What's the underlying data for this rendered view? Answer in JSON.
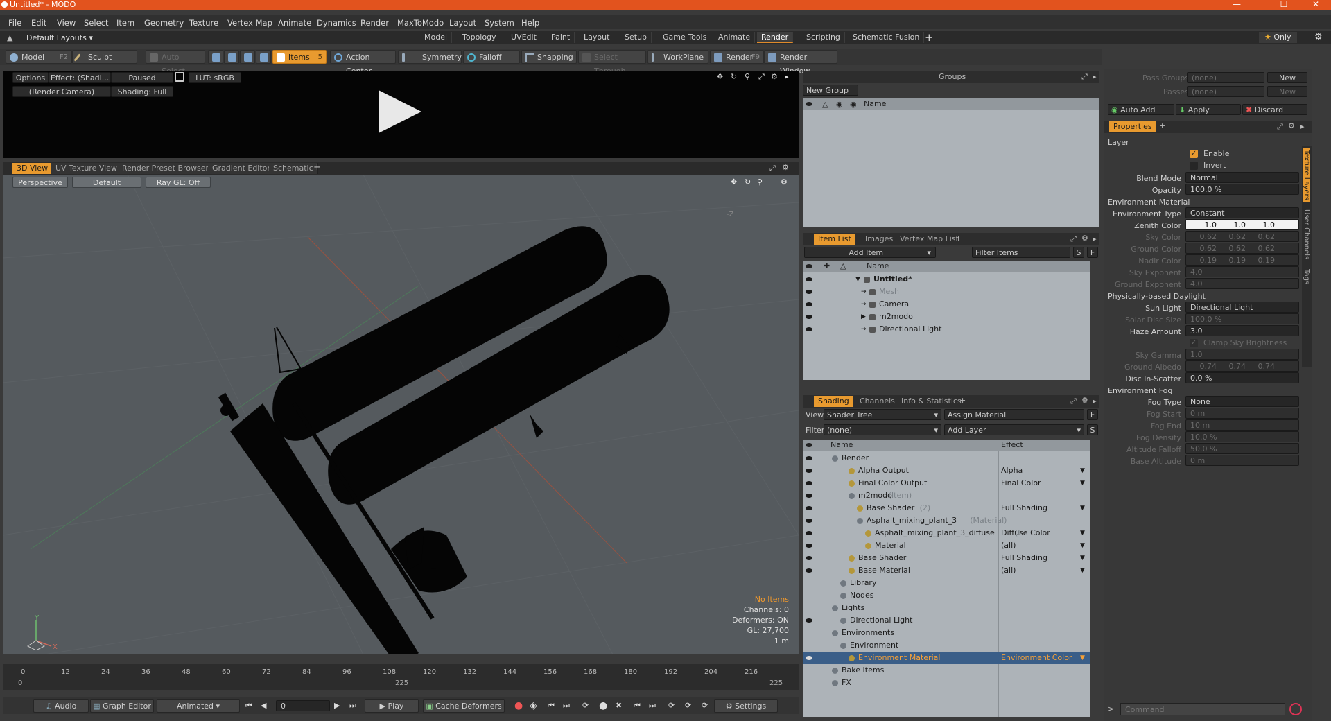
{
  "window": {
    "title": "Untitled* - MODO",
    "minimize": "—",
    "maximize": "☐",
    "close": "✕"
  },
  "menu": [
    "File",
    "Edit",
    "View",
    "Select",
    "Item",
    "Geometry",
    "Texture",
    "Vertex Map",
    "Animate",
    "Dynamics",
    "Render",
    "MaxToModo",
    "Layout",
    "System",
    "Help"
  ],
  "layouts_label": "Default Layouts",
  "tabs": [
    "Model",
    "Topology",
    "UVEdit",
    "Paint",
    "Layout",
    "Setup",
    "Game Tools",
    "Animate",
    "Render",
    "Scripting",
    "Schematic Fusion"
  ],
  "tabs_active": "Render",
  "only_label": "Only",
  "tools": {
    "model": "Model",
    "model_key": "F2",
    "sculpt": "Sculpt",
    "auto_select": "Auto Select",
    "items": "Items",
    "items_key": "5",
    "action_center": "Action Center",
    "symmetry": "Symmetry",
    "falloff": "Falloff",
    "snapping": "Snapping",
    "select_through": "Select Through",
    "workplane": "WorkPlane",
    "render": "Render",
    "render_key": "F9",
    "render_window": "Render Window"
  },
  "render_panel": {
    "options": "Options",
    "effect": "Effect: (Shadi...",
    "paused": "Paused",
    "lut": "LUT: sRGB",
    "camera": "(Render Camera)",
    "shading": "Shading: Full"
  },
  "view_tabs": [
    "3D View",
    "UV Texture View",
    "Render Preset Browser",
    "Gradient Editor",
    "Schematic"
  ],
  "viewport": {
    "perspective": "Perspective",
    "default": "Default",
    "raygl": "Ray GL: Off",
    "axis_z": "-Z",
    "axis_y": "Y",
    "axis_x": "X"
  },
  "viewport_info": {
    "items": "No Items",
    "channels": "Channels: 0",
    "deformers": "Deformers: ON",
    "gl": "GL: 27,700",
    "scale": "1 m"
  },
  "timeline": {
    "ticks": [
      "0",
      "12",
      "24",
      "36",
      "48",
      "60",
      "72",
      "84",
      "96",
      "108",
      "120",
      "132",
      "144",
      "156",
      "168",
      "180",
      "192",
      "204",
      "216"
    ],
    "start": "0",
    "mid": "225",
    "end": "225"
  },
  "bottom": {
    "audio": "Audio",
    "graph_editor": "Graph Editor",
    "animated": "Animated",
    "frame": "0",
    "play": "Play",
    "cache": "Cache Deformers",
    "settings": "Settings"
  },
  "groups": {
    "title": "Groups",
    "new_group": "New Group",
    "col_name": "Name"
  },
  "item_list": {
    "tabs": [
      "Item List",
      "Images",
      "Vertex Map List"
    ],
    "add_item": "Add Item",
    "filter": "Filter Items",
    "s": "S",
    "f": "F",
    "col_name": "Name",
    "rows": [
      {
        "label": "Untitled*",
        "indent": 0
      },
      {
        "label": "Mesh",
        "indent": 1,
        "dim": true
      },
      {
        "label": "Camera",
        "indent": 1
      },
      {
        "label": "m2modo",
        "indent": 1
      },
      {
        "label": "Directional Light",
        "indent": 1
      }
    ]
  },
  "shading": {
    "tabs": [
      "Shading",
      "Channels",
      "Info & Statistics"
    ],
    "view_label": "View",
    "view_value": "Shader Tree",
    "assign": "Assign Material",
    "f": "F",
    "filter_label": "Filter",
    "filter_value": "(none)",
    "add_layer": "Add Layer",
    "s": "S",
    "col_name": "Name",
    "col_effect": "Effect",
    "rows": [
      {
        "label": "Render",
        "suffix": "",
        "effect": "",
        "indent": 0,
        "eye": true
      },
      {
        "label": "Alpha Output",
        "suffix": "",
        "effect": "Alpha",
        "indent": 2,
        "eye": true
      },
      {
        "label": "Final Color Output",
        "suffix": "",
        "effect": "Final Color",
        "indent": 2,
        "eye": true
      },
      {
        "label": "m2modo",
        "suffix": "(Item)",
        "effect": "",
        "indent": 2,
        "eye": true
      },
      {
        "label": "Base Shader",
        "suffix": "(2)",
        "effect": "Full Shading",
        "indent": 3,
        "eye": true
      },
      {
        "label": "Asphalt_mixing_plant_3",
        "suffix": "(Material)",
        "effect": "",
        "indent": 3,
        "eye": true
      },
      {
        "label": "Asphalt_mixing_plant_3_diffuse",
        "suffix": "(I...",
        "effect": "Diffuse Color",
        "indent": 4,
        "eye": true
      },
      {
        "label": "Material",
        "suffix": "",
        "effect": "(all)",
        "indent": 4,
        "eye": true
      },
      {
        "label": "Base Shader",
        "suffix": "",
        "effect": "Full Shading",
        "indent": 2,
        "eye": true
      },
      {
        "label": "Base Material",
        "suffix": "",
        "effect": "(all)",
        "indent": 2,
        "eye": true
      },
      {
        "label": "Library",
        "suffix": "",
        "effect": "",
        "indent": 1,
        "eye": false
      },
      {
        "label": "Nodes",
        "suffix": "",
        "effect": "",
        "indent": 1,
        "eye": false
      },
      {
        "label": "Lights",
        "suffix": "",
        "effect": "",
        "indent": 0,
        "eye": false
      },
      {
        "label": "Directional Light",
        "suffix": "",
        "effect": "",
        "indent": 1,
        "eye": true
      },
      {
        "label": "Environments",
        "suffix": "",
        "effect": "",
        "indent": 0,
        "eye": false
      },
      {
        "label": "Environment",
        "suffix": "",
        "effect": "",
        "indent": 1,
        "eye": false
      },
      {
        "label": "Environment Material",
        "suffix": "",
        "effect": "Environment Color",
        "indent": 2,
        "eye": true,
        "selected": true
      },
      {
        "label": "Bake Items",
        "suffix": "",
        "effect": "",
        "indent": 0,
        "eye": false
      },
      {
        "label": "FX",
        "suffix": "",
        "effect": "",
        "indent": 0,
        "eye": false
      }
    ]
  },
  "passes": {
    "pass_groups": "Pass Groups",
    "pass_groups_val": "(none)",
    "passes": "Passes",
    "passes_val": "(none)",
    "new": "New",
    "new2": "New",
    "auto_add": "Auto Add",
    "apply": "Apply",
    "discard": "Discard"
  },
  "properties": {
    "tab": "Properties",
    "side_tabs": [
      "Texture Layers",
      "User Channels",
      "Tags"
    ],
    "layer": "Layer",
    "enable": "Enable",
    "invert": "Invert",
    "blend_mode": "Blend Mode",
    "blend_val": "Normal",
    "opacity": "Opacity",
    "opacity_val": "100.0 %",
    "env_material": "Environment Material",
    "env_type": "Environment Type",
    "env_type_val": "Constant",
    "zenith": "Zenith Color",
    "zenith_vals": [
      "1.0",
      "1.0",
      "1.0"
    ],
    "sky": "Sky Color",
    "sky_vals": [
      "0.62",
      "0.62",
      "0.62"
    ],
    "ground": "Ground Color",
    "ground_vals": [
      "0.62",
      "0.62",
      "0.62"
    ],
    "nadir": "Nadir Color",
    "nadir_vals": [
      "0.19",
      "0.19",
      "0.19"
    ],
    "sky_exp": "Sky Exponent",
    "sky_exp_val": "4.0",
    "ground_exp": "Ground Exponent",
    "ground_exp_val": "4.0",
    "daylight": "Physically-based Daylight",
    "sun_light": "Sun Light",
    "sun_light_val": "Directional Light",
    "solar": "Solar Disc Size",
    "solar_val": "100.0 %",
    "haze": "Haze Amount",
    "haze_val": "3.0",
    "clamp": "Clamp Sky Brightness",
    "sky_gamma": "Sky Gamma",
    "sky_gamma_val": "1.0",
    "ground_albedo": "Ground Albedo",
    "ground_albedo_vals": [
      "0.74",
      "0.74",
      "0.74"
    ],
    "disc": "Disc In-Scatter",
    "disc_val": "0.0 %",
    "env_fog": "Environment Fog",
    "fog_type": "Fog Type",
    "fog_type_val": "None",
    "fog_start": "Fog Start",
    "fog_start_val": "0 m",
    "fog_end": "Fog End",
    "fog_end_val": "10 m",
    "fog_density": "Fog Density",
    "fog_density_val": "10.0 %",
    "alt_falloff": "Altitude Falloff",
    "alt_falloff_val": "50.0 %",
    "base_alt": "Base Altitude",
    "base_alt_val": "0 m"
  },
  "command_placeholder": "Command",
  "colors": {
    "accent": "#e89a2f",
    "titlebar": "#e2531e",
    "selection": "#3a5e88"
  }
}
